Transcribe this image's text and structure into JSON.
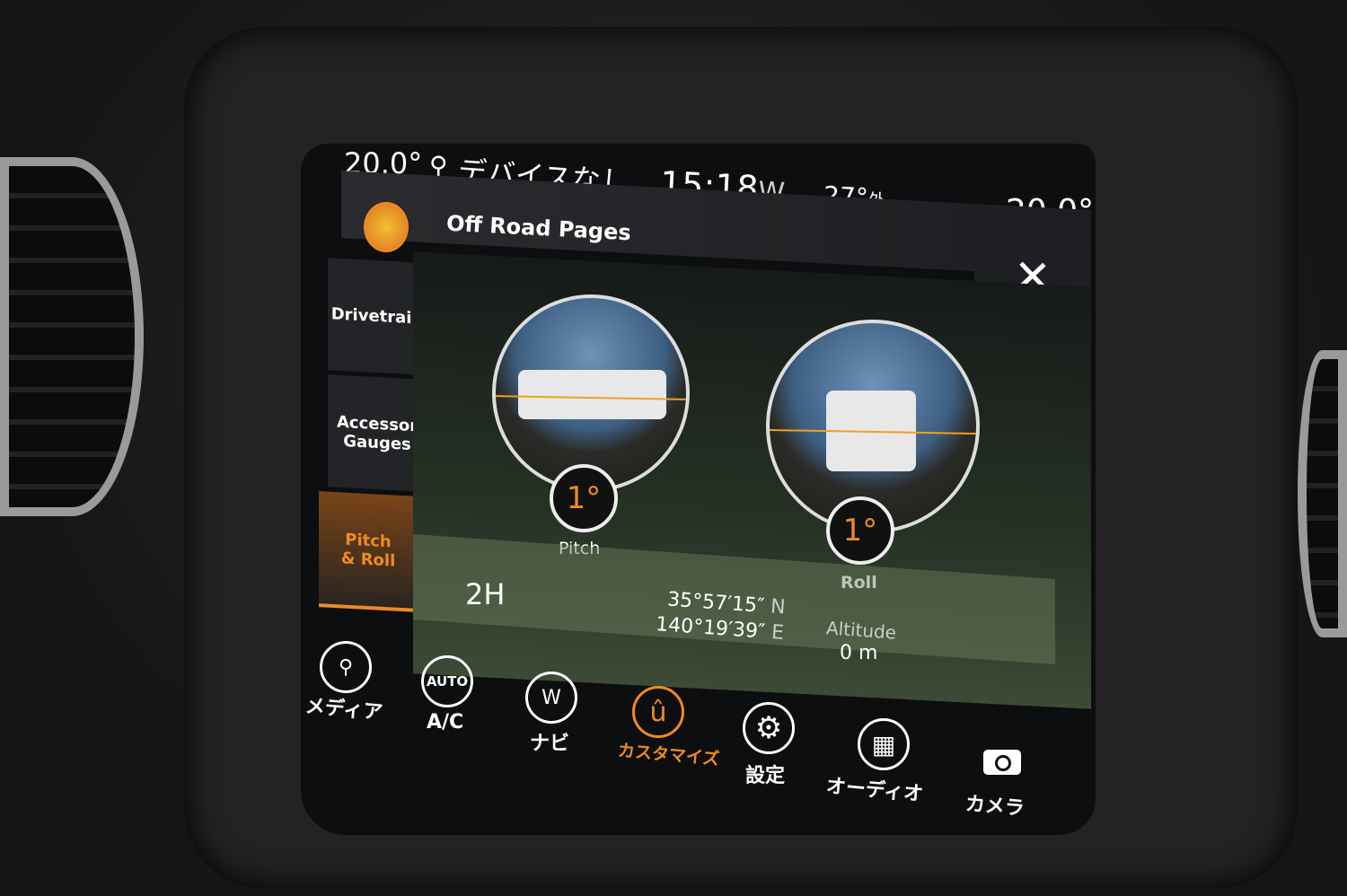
{
  "status_bar": {
    "temp_left": "20.0°",
    "usb_icon": "usb-icon",
    "device_status": "デバイスなし",
    "time": "15:18",
    "compass": "W",
    "outside_temp": "27°",
    "outside_label": "外",
    "temp_right": "20.0°"
  },
  "header": {
    "title": "Off Road Pages",
    "icon": "tire-tread-icon",
    "close_icon": "close-icon"
  },
  "sidebar": {
    "items": [
      {
        "label": "Drivetrain",
        "active": false
      },
      {
        "label": "Accessory Gauges",
        "active": false
      },
      {
        "label": "Pitch & Roll",
        "active": true
      }
    ]
  },
  "gauges": {
    "pitch": {
      "value": "1°",
      "label": "Pitch"
    },
    "roll": {
      "value": "1°",
      "label": "Roll"
    }
  },
  "info": {
    "drive_mode": "2H",
    "lat_value": "35°57′15″",
    "lat_dir": "N",
    "lon_value": "140°19′39″",
    "lon_dir": "E",
    "altitude_label": "Altitude",
    "altitude_value": "0 m"
  },
  "dock": [
    {
      "label": "メディア",
      "icon": "usb-icon",
      "glyph": "⚲"
    },
    {
      "label": "A/C",
      "icon": "climate-auto-icon",
      "glyph": "AUTO"
    },
    {
      "label": "ナビ",
      "icon": "compass-icon",
      "glyph": "W"
    },
    {
      "label": "カスタマイズ",
      "icon": "uconnect-icon",
      "glyph": "û",
      "active": true
    },
    {
      "label": "設定",
      "icon": "gear-icon",
      "glyph": "⚙"
    },
    {
      "label": "オーディオ",
      "icon": "equalizer-icon",
      "glyph": "▦"
    },
    {
      "label": "カメラ",
      "icon": "camera-icon",
      "glyph": "📷"
    }
  ],
  "colors": {
    "accent": "#f08a20",
    "horizon": "#f0a020"
  }
}
